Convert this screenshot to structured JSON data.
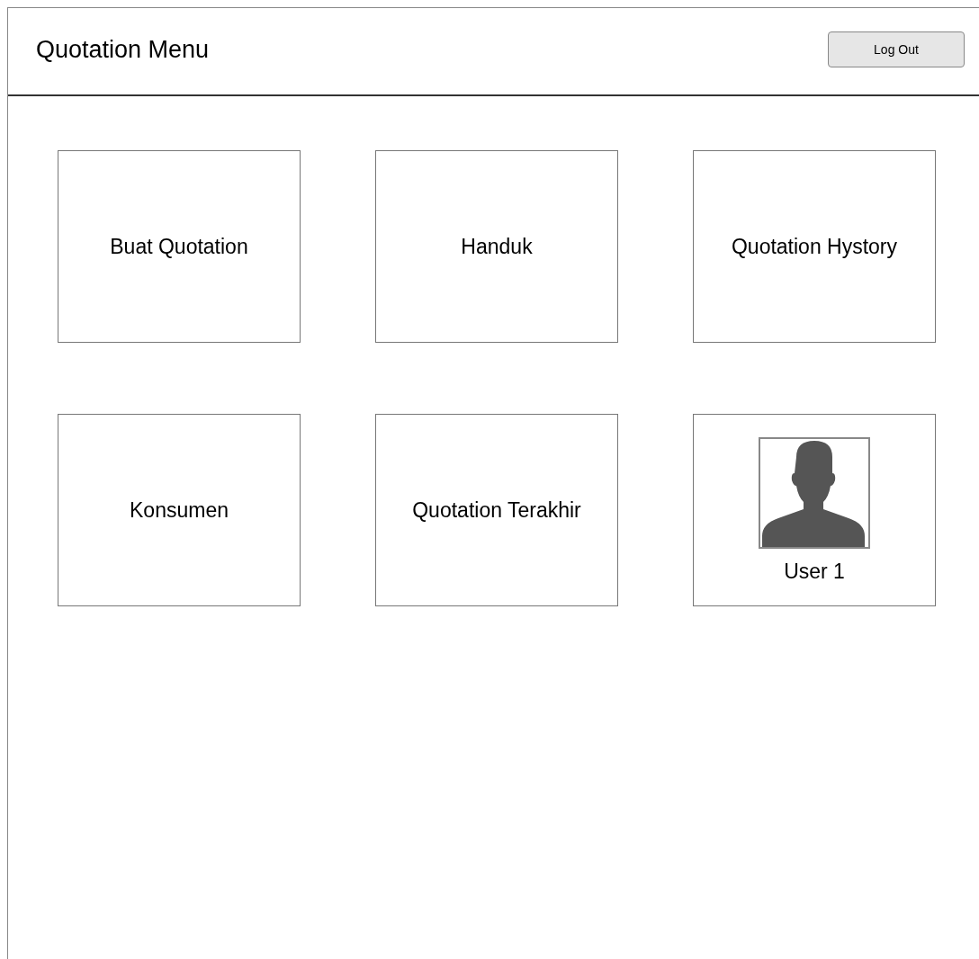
{
  "header": {
    "title": "Quotation Menu",
    "logout_button": "Log Out"
  },
  "tiles": [
    {
      "kind": "menu",
      "label": "Buat Quotation"
    },
    {
      "kind": "menu",
      "label": "Handuk"
    },
    {
      "kind": "menu",
      "label": "Quotation Hystory"
    },
    {
      "kind": "menu",
      "label": "Konsumen"
    },
    {
      "kind": "menu",
      "label": "Quotation Terakhir"
    },
    {
      "kind": "user",
      "label": "User 1"
    }
  ]
}
